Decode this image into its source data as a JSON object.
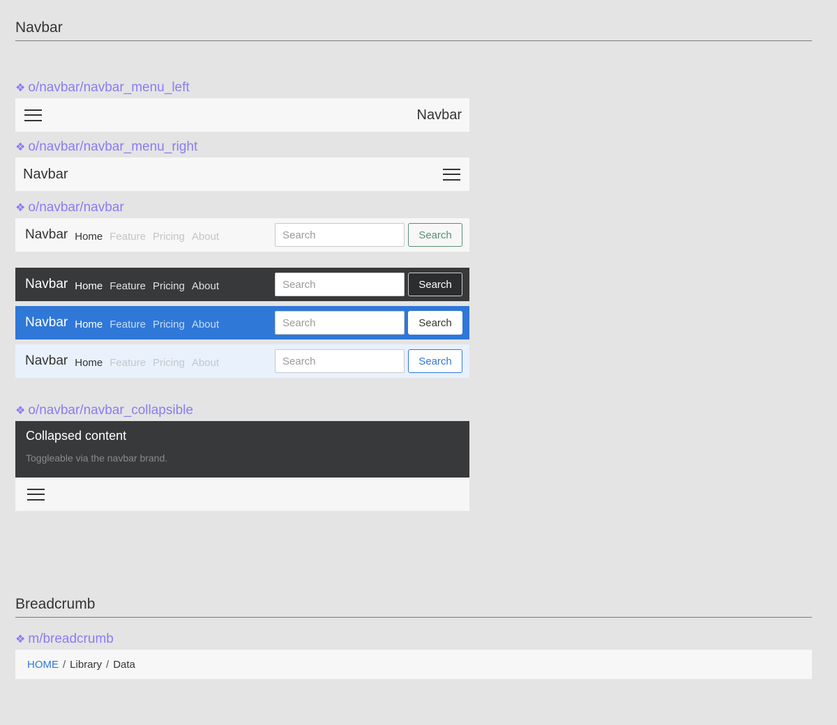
{
  "sections": {
    "navbar_title": "Navbar",
    "breadcrumb_title": "Breadcrumb"
  },
  "components": {
    "menu_left": "o/navbar/navbar_menu_left",
    "menu_right": "o/navbar/navbar_menu_right",
    "navbar": "o/navbar/navbar",
    "collapsible": "o/navbar/navbar_collapsible",
    "breadcrumb": "m/breadcrumb"
  },
  "navbar": {
    "brand": "Navbar",
    "links": [
      "Home",
      "Feature",
      "Pricing",
      "About"
    ],
    "search_placeholder": "Search",
    "search_button": "Search"
  },
  "collapsible": {
    "title": "Collapsed content",
    "subtitle": "Toggleable via the navbar brand."
  },
  "breadcrumb": {
    "items": [
      "HOME",
      "Library",
      "Data"
    ],
    "separator": "/"
  },
  "icons": {
    "component": "diamond-cluster-icon",
    "menu": "hamburger-menu-icon"
  },
  "colors": {
    "label_purple": "#8a7cf2",
    "primary_blue": "#2f78d8",
    "dark_bar": "#38393a",
    "light_bar": "#f7f7f7",
    "pale_blue": "#e8f1fc",
    "success_outline": "#5a8f73"
  }
}
